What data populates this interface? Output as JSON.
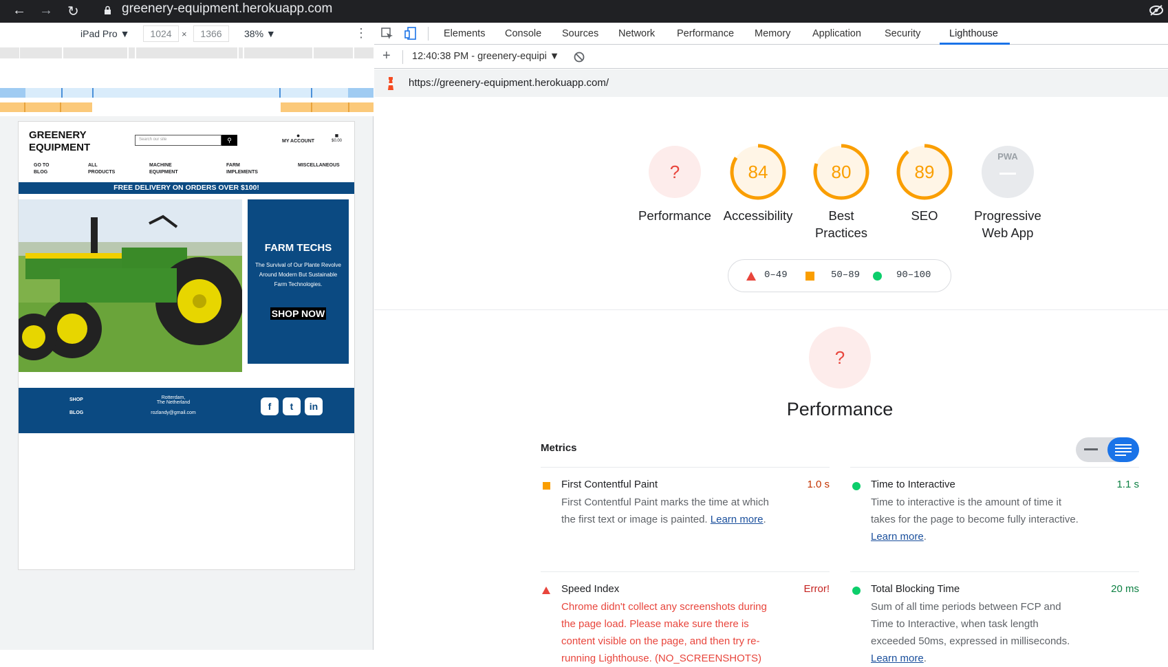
{
  "browser": {
    "url": "greenery-equipment.herokuapp.com"
  },
  "device_toolbar": {
    "device": "iPad Pro",
    "width": "1024",
    "height": "1366",
    "zoom": "38%"
  },
  "site": {
    "logo_line1": "GREENERY",
    "logo_line2": "EQUIPMENT",
    "search_placeholder": "Search our site",
    "account_label": "MY ACCOUNT",
    "cart_total": "$0.00",
    "menu": [
      "GO TO\nBLOG",
      "ALL\nPRODUCTS",
      "MACHINE\nEQUIPMENT",
      "FARM\nIMPLEMENTS",
      "MISCELLANEOUS"
    ],
    "banner": "FREE DELIVERY ON ORDERS OVER $100!",
    "promo_title": "FARM TECHS",
    "promo_text": "The Survival of Our Plante Revolve Around Modern But Sustainable Farm Technologies.",
    "promo_button": "SHOP NOW",
    "footer_link1": "SHOP",
    "footer_link2": "BLOG",
    "footer_city": "Rotterdam,",
    "footer_country": "The Netherland",
    "footer_email": "rozlandy@gmail.com"
  },
  "devtools": {
    "tabs": [
      "Elements",
      "Console",
      "Sources",
      "Network",
      "Performance",
      "Memory",
      "Application",
      "Security",
      "Lighthouse"
    ],
    "active_tab": "Lighthouse",
    "report_selector": "12:40:38 PM - greenery-equipi",
    "report_url": "https://greenery-equipment.herokuapp.com/"
  },
  "lighthouse": {
    "gauges": [
      {
        "label": "Performance",
        "score": "?",
        "color": "#e8453c"
      },
      {
        "label": "Accessibility",
        "score": "84",
        "color": "#fa9e00"
      },
      {
        "label": "Best\nPractices",
        "score": "80",
        "color": "#fa9e00"
      },
      {
        "label": "SEO",
        "score": "89",
        "color": "#fa9e00"
      },
      {
        "label": "Progressive\nWeb App",
        "score": "PWA",
        "color": "#9aa0a6"
      }
    ],
    "legend": [
      "0–49",
      "50–89",
      "90–100"
    ],
    "section_title": "Performance",
    "section_score": "?",
    "metrics_heading": "Metrics",
    "metrics": [
      {
        "title": "First Contentful Paint",
        "value": "1.0 s",
        "status": "average",
        "desc": "First Contentful Paint marks the time at which the first text or image is painted.",
        "link": "Learn more"
      },
      {
        "title": "Time to Interactive",
        "value": "1.1 s",
        "status": "pass",
        "desc": "Time to interactive is the amount of time it takes for the page to become fully interactive.",
        "link": "Learn more"
      },
      {
        "title": "Speed Index",
        "value": "Error!",
        "status": "fail",
        "desc": "Chrome didn't collect any screenshots during the page load. Please make sure there is content visible on the page, and then try re-running Lighthouse. (NO_SCREENSHOTS)",
        "link": ""
      },
      {
        "title": "Total Blocking Time",
        "value": "20 ms",
        "status": "pass",
        "desc": "Sum of all time periods between FCP and Time to Interactive, when task length exceeded 50ms, expressed in milliseconds.",
        "link": "Learn more"
      }
    ]
  }
}
